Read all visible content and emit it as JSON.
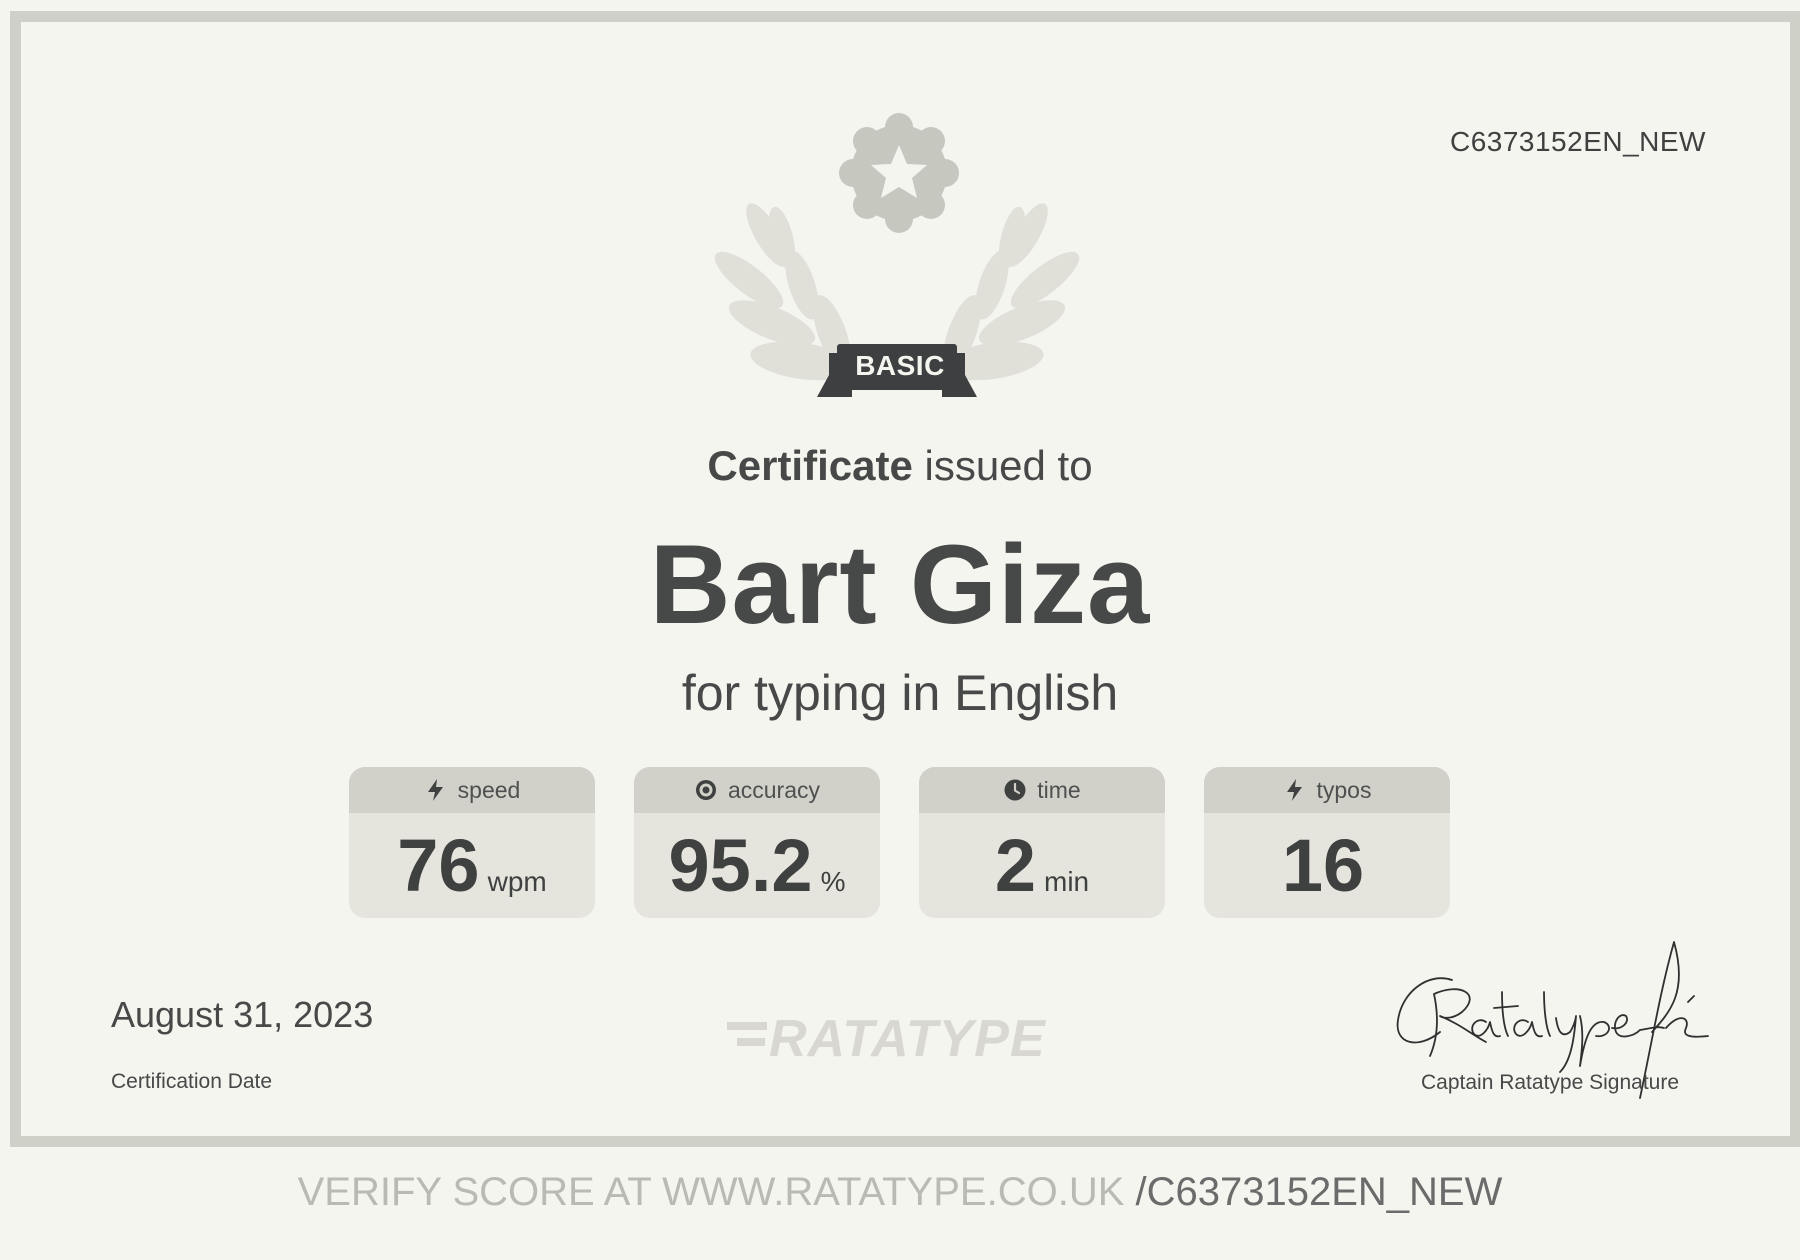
{
  "certificate": {
    "id": "C6373152EN_NEW",
    "level_label": "BASIC",
    "heading_strong": "Certificate",
    "heading_rest": "issued to",
    "recipient": "Bart Giza",
    "subject": "for typing in English"
  },
  "stats": [
    {
      "label": "speed",
      "value": "76",
      "unit": "wpm",
      "icon": "lightning-icon"
    },
    {
      "label": "accuracy",
      "value": "95.2",
      "unit": "%",
      "icon": "target-icon"
    },
    {
      "label": "time",
      "value": "2",
      "unit": "min",
      "icon": "clock-icon"
    },
    {
      "label": "typos",
      "value": "16",
      "unit": "",
      "icon": "lightning-icon"
    }
  ],
  "footer": {
    "date_value": "August 31, 2023",
    "date_label": "Certification Date",
    "brand": "RATATYPE",
    "signature_label": "Captain Ratatype Signature"
  },
  "verify": {
    "prefix": "VERIFY SCORE AT WWW.RATATYPE.CO.UK ",
    "code": "/C6373152EN_NEW"
  },
  "colors": {
    "background": "#f4f5ef",
    "frame": "#cfd0c8",
    "text": "#474848",
    "card": "#e5e5dd",
    "card_header": "#d1d1c9",
    "badge": "#3d3f40"
  }
}
